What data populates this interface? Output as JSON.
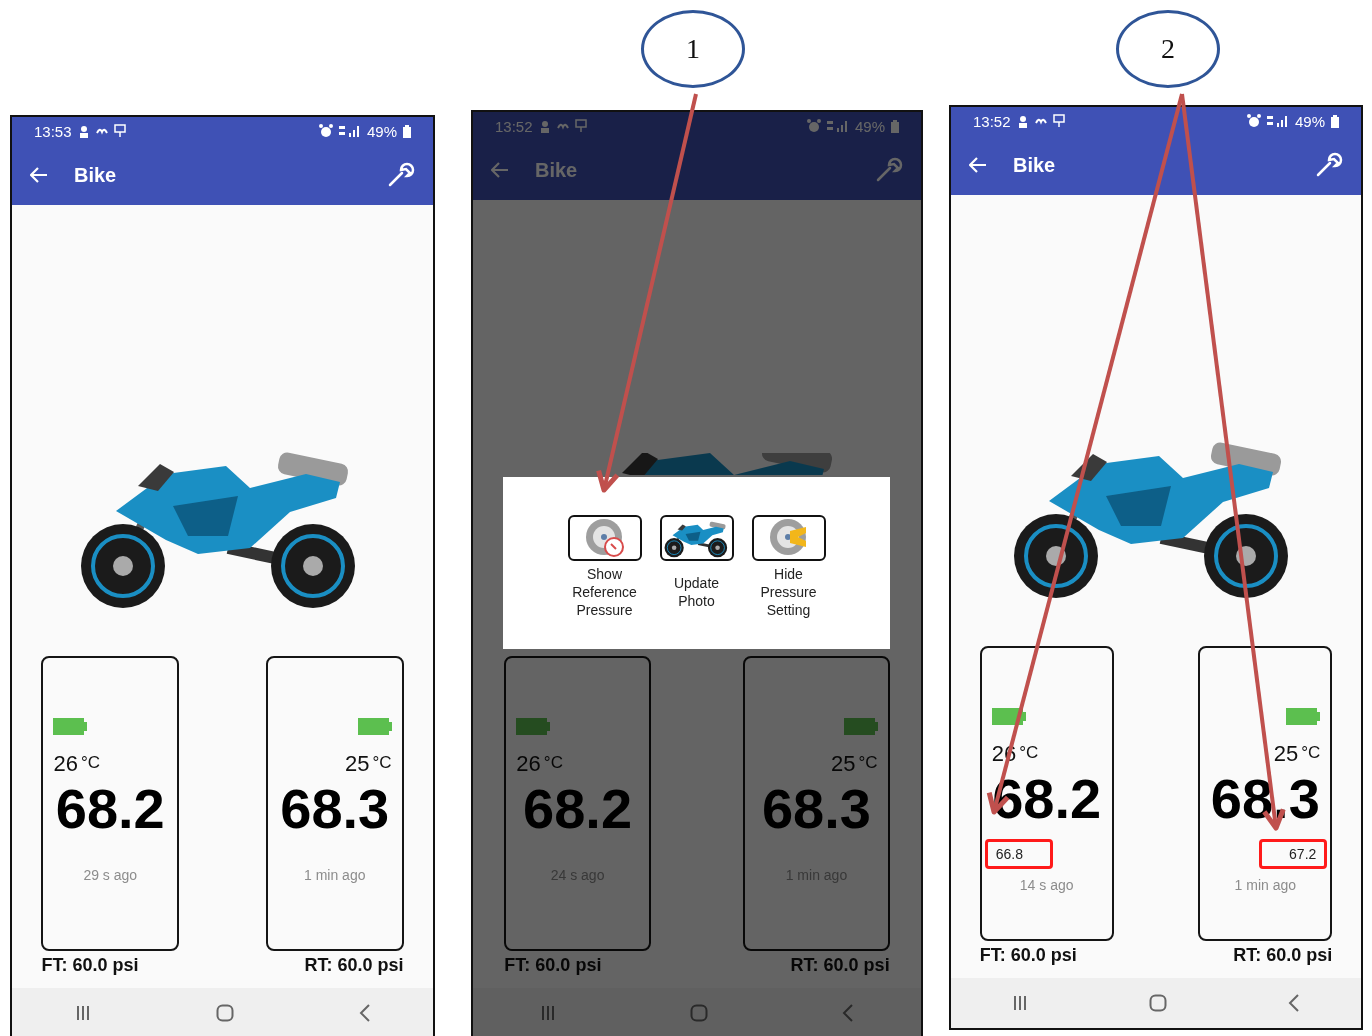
{
  "callouts": [
    {
      "label": "1"
    },
    {
      "label": "2"
    }
  ],
  "phones": [
    {
      "status_bar": {
        "time": "13:53",
        "battery": "49%"
      },
      "app_bar": {
        "title": "Bike"
      },
      "dimmed": false,
      "tires": [
        {
          "kind": "front",
          "temperature": "26",
          "unit": "°C",
          "pressure": "68.2",
          "updated": "29 s ago"
        },
        {
          "kind": "rear",
          "temperature": "25",
          "unit": "°C",
          "pressure": "68.3",
          "updated": "1 min ago"
        }
      ],
      "targets": [
        "FT: 60.0 psi",
        "RT: 60.0 psi"
      ]
    },
    {
      "status_bar": {
        "time": "13:52",
        "battery": "49%"
      },
      "app_bar": {
        "title": "Bike"
      },
      "dimmed": true,
      "tires": [
        {
          "kind": "front",
          "temperature": "26",
          "unit": "°C",
          "pressure": "68.2",
          "updated": "24 s ago"
        },
        {
          "kind": "rear",
          "temperature": "25",
          "unit": "°C",
          "pressure": "68.3",
          "updated": "1 min ago"
        }
      ],
      "targets": [
        "FT: 60.0 psi",
        "RT: 60.0 psi"
      ],
      "menu": {
        "options": [
          {
            "kind": "reference",
            "label": "Show Reference Pressure"
          },
          {
            "kind": "photo",
            "label": "Update Photo"
          },
          {
            "kind": "setting",
            "label": "Hide Pressure Setting"
          }
        ]
      }
    },
    {
      "status_bar": {
        "time": "13:52",
        "battery": "49%"
      },
      "app_bar": {
        "title": "Bike"
      },
      "dimmed": false,
      "tires": [
        {
          "kind": "front",
          "temperature": "26",
          "unit": "°C",
          "pressure": "68.2",
          "reference": "66.8",
          "highlighted": true,
          "updated": "14 s ago"
        },
        {
          "kind": "rear",
          "temperature": "25",
          "unit": "°C",
          "pressure": "68.3",
          "reference": "67.2",
          "highlighted": true,
          "updated": "1 min ago"
        }
      ],
      "targets": [
        "FT: 60.0 psi",
        "RT: 60.0 psi"
      ]
    }
  ]
}
